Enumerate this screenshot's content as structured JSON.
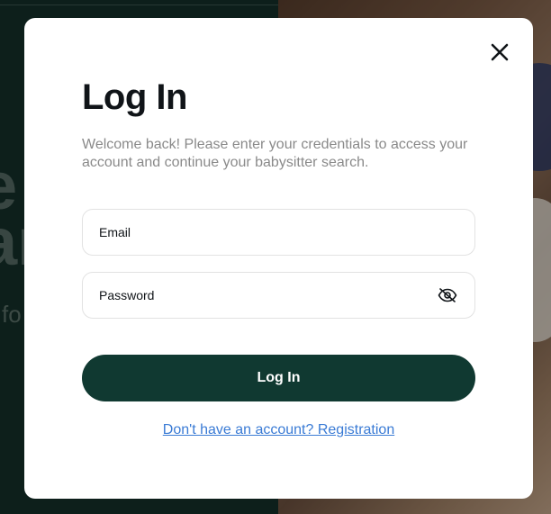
{
  "background": {
    "line_1": "e",
    "line_2": "ar",
    "line_3": "fo"
  },
  "modal": {
    "close_icon": "close-icon",
    "title": "Log In",
    "subtitle": "Welcome back! Please enter your credentials to access your account and continue your babysitter search.",
    "email": {
      "placeholder": "Email",
      "value": ""
    },
    "password": {
      "placeholder": "Password",
      "value": "",
      "toggle_icon": "eye-off-icon"
    },
    "submit_label": "Log In",
    "register_link": "Don't have an account? Registration"
  },
  "colors": {
    "primary": "#103931",
    "link": "#3a7bd5",
    "heading": "#101418",
    "muted": "#8a8a8a",
    "field_border": "#e2e2e2"
  }
}
